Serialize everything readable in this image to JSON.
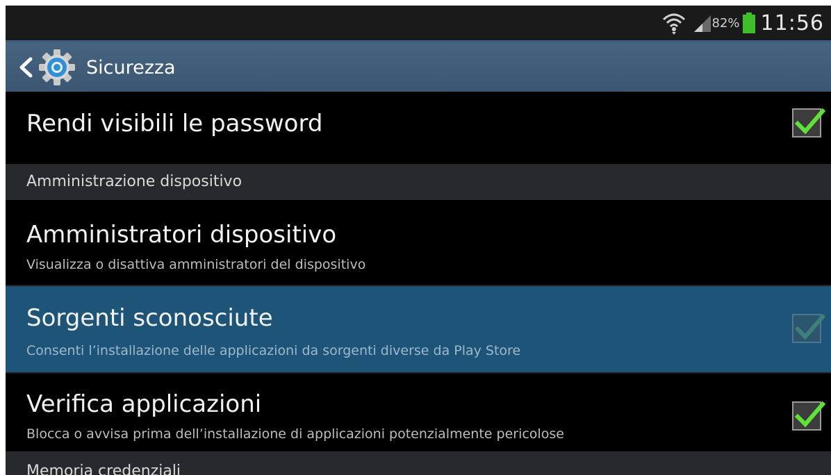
{
  "status_bar": {
    "battery_percent": "82%",
    "time": "11:56",
    "icons": [
      "wifi-icon",
      "signal-icon",
      "battery-icon"
    ],
    "battery_color": "#3fbf2a"
  },
  "action_bar": {
    "title": "Sicurezza",
    "icons": [
      "back-icon",
      "settings-gear-icon"
    ],
    "background": "#3f5c78"
  },
  "list": {
    "show_passwords": {
      "title": "Rendi visibili le password",
      "checked": true
    },
    "section_device_admin": "Amministrazione dispositivo",
    "device_admins": {
      "title": "Amministratori dispositivo",
      "subtitle": "Visualizza o disattiva amministratori del dispositivo"
    },
    "unknown_sources": {
      "title": "Sorgenti sconosciute",
      "subtitle": "Consenti l’installazione delle applicazioni da sorgenti diverse da Play Store",
      "checked": true,
      "highlighted": true
    },
    "verify_apps": {
      "title": "Verifica applicazioni",
      "subtitle": "Blocca o avvisa prima dell’installazione di applicazioni potenzialmente pericolose",
      "checked": true
    },
    "section_credentials": "Memoria credenziali"
  },
  "colors": {
    "check_green": "#5fe03a",
    "highlight_row": "#1d5478"
  }
}
